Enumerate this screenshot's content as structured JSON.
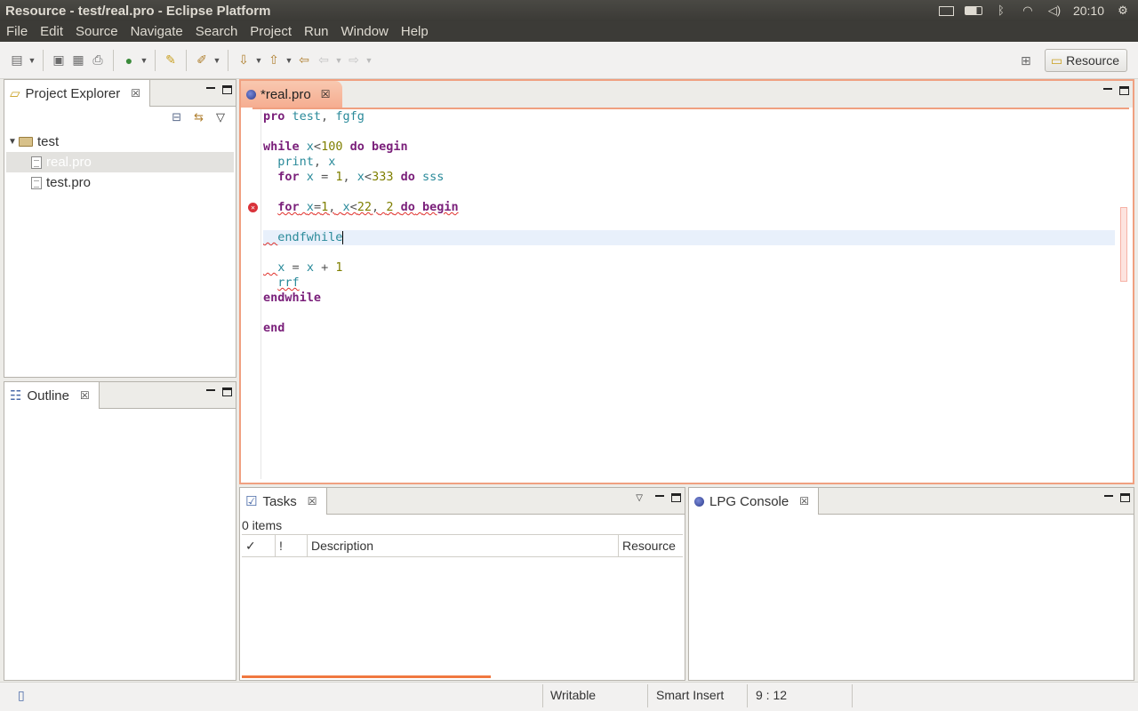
{
  "window": {
    "title": "Resource - test/real.pro - Eclipse Platform"
  },
  "tray": {
    "time": "20:10",
    "mail_icon": "mail-icon",
    "battery_icon": "battery-icon",
    "bluetooth_icon": "bluetooth-icon",
    "wifi_icon": "wifi-icon",
    "volume_icon": "volume-icon",
    "power_icon": "gear-icon"
  },
  "menu": [
    "File",
    "Edit",
    "Source",
    "Navigate",
    "Search",
    "Project",
    "Run",
    "Window",
    "Help"
  ],
  "perspective": {
    "label": "Resource"
  },
  "project_explorer": {
    "tab_label": "Project Explorer",
    "tree": [
      {
        "label": "test",
        "type": "folder",
        "expanded": true
      },
      {
        "label": "real.pro",
        "type": "file",
        "selected": true
      },
      {
        "label": "test.pro",
        "type": "file",
        "selected": false
      }
    ]
  },
  "outline": {
    "tab_label": "Outline"
  },
  "editor": {
    "tab_label": "*real.pro",
    "cursor_line": 9,
    "error_line": 7
  },
  "tasks": {
    "tab_label": "Tasks",
    "count": "0 items",
    "columns": [
      "✓",
      "!",
      "Description",
      "Resource"
    ]
  },
  "console": {
    "tab_label": "LPG Console"
  },
  "status": {
    "writable": "Writable",
    "insert_mode": "Smart Insert",
    "position": "9 : 12"
  },
  "colors": {
    "accent": "#f0a080",
    "keyword": "#7a1f7a",
    "number": "#7f7f00",
    "identifier": "#2a8a9a",
    "error": "#d9323a"
  }
}
